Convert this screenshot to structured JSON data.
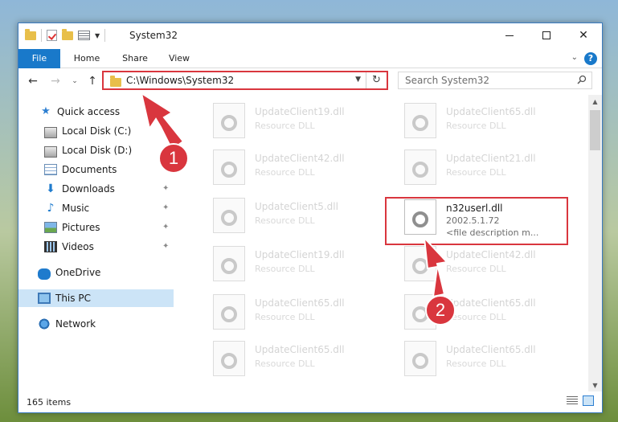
{
  "window": {
    "title": "System32",
    "controls": {
      "minimize": "minimize",
      "maximize": "maximize",
      "close": "✕"
    }
  },
  "ribbon": {
    "tabs": [
      {
        "label": "File"
      },
      {
        "label": "Home"
      },
      {
        "label": "Share"
      },
      {
        "label": "View"
      }
    ],
    "help": "?"
  },
  "nav": {
    "back": "←",
    "forward": "→",
    "recent": "⌄",
    "up": "↑",
    "address": "C:\\Windows\\System32",
    "refresh": "↻",
    "search_placeholder": "Search System32"
  },
  "sidebar": {
    "items": [
      {
        "label": "Quick access",
        "icon": "star-icon",
        "pinned": false
      },
      {
        "label": "Local Disk (C:)",
        "icon": "local-disk-icon",
        "pinned": true
      },
      {
        "label": "Local Disk (D:)",
        "icon": "local-disk-icon",
        "pinned": true
      },
      {
        "label": "Documents",
        "icon": "documents-icon",
        "pinned": true
      },
      {
        "label": "Downloads",
        "icon": "downloads-icon",
        "pinned": true
      },
      {
        "label": "Music",
        "icon": "music-icon",
        "pinned": true
      },
      {
        "label": "Pictures",
        "icon": "pictures-icon",
        "pinned": true
      },
      {
        "label": "Videos",
        "icon": "videos-icon",
        "pinned": true
      },
      {
        "label": "OneDrive",
        "icon": "onedrive-icon",
        "pinned": false
      },
      {
        "label": "This PC",
        "icon": "this-pc-icon",
        "pinned": false,
        "selected": true
      },
      {
        "label": "Network",
        "icon": "network-icon",
        "pinned": false
      }
    ]
  },
  "files": [
    {
      "name": "UpdateClient19.dll",
      "type": "Resource DLL"
    },
    {
      "name": "UpdateClient65.dll",
      "type": "Resource DLL"
    },
    {
      "name": "UpdateClient42.dll",
      "type": "Resource DLL"
    },
    {
      "name": "UpdateClient21.dll",
      "type": "Resource DLL"
    },
    {
      "name": "UpdateClient5.dll",
      "type": "Resource DLL"
    },
    {
      "name": "n32userl.dll",
      "version": "2002.5.1.72",
      "description": "<file description m...",
      "focus": true
    },
    {
      "name": "UpdateClient19.dll",
      "type": "Resource DLL"
    },
    {
      "name": "UpdateClient42.dll",
      "type": "Resource DLL"
    },
    {
      "name": "UpdateClient65.dll",
      "type": "Resource DLL"
    },
    {
      "name": "UpdateClient65.dll",
      "type": "Resource DLL"
    },
    {
      "name": "UpdateClient65.dll",
      "type": "Resource DLL"
    },
    {
      "name": "UpdateClient65.dll",
      "type": "Resource DLL"
    }
  ],
  "status": {
    "item_count": "165 items"
  },
  "annotations": {
    "step1": "1",
    "step2": "2",
    "color": "#d9363e"
  },
  "colors": {
    "accent": "#1979ca",
    "selection": "#cce4f7",
    "highlight": "#d9363e"
  }
}
